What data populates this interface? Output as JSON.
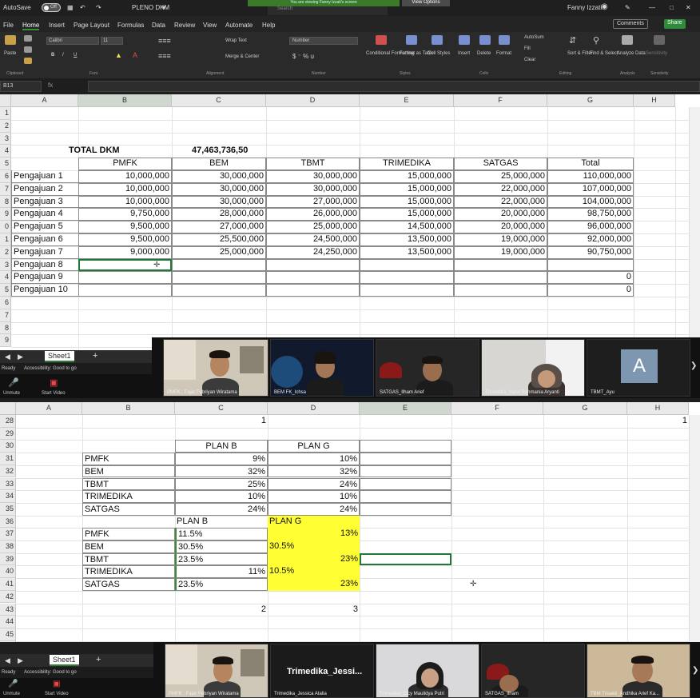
{
  "titlebar": {
    "autosave": "AutoSave",
    "toggle": "Off",
    "filename": "PLENO DKM",
    "banner": "You are viewing Fanny Izzati's screen",
    "banner_btn": "View Options",
    "search": "Search",
    "user": "Fanny Izzati"
  },
  "menu": [
    "File",
    "Home",
    "Insert",
    "Page Layout",
    "Formulas",
    "Data",
    "Review",
    "View",
    "Automate",
    "Help"
  ],
  "menu_right": {
    "comments": "Comments",
    "share": "Share"
  },
  "ribbon": {
    "groups": [
      "Clipboard",
      "Font",
      "Alignment",
      "Number",
      "Styles",
      "Cells",
      "Editing",
      "Analysis",
      "Sensitivity"
    ],
    "paste": "Paste",
    "font_name": "Calibri",
    "font_size": "11",
    "wrap": "Wrap Text",
    "merge": "Merge & Center",
    "number_format": "Number",
    "cond": "Conditional Formatting",
    "format_table": "Format as Table",
    "cell_styles": "Cell Styles",
    "insert": "Insert",
    "delete": "Delete",
    "format": "Format",
    "autosum": "AutoSum",
    "fill": "Fill",
    "clear": "Clear",
    "sort": "Sort & Filter",
    "find": "Find & Select",
    "analyze": "Analyze Data",
    "sensitivity": "Sensitivity"
  },
  "formula": {
    "namebox": "B13",
    "fx": "fx"
  },
  "top_sheet": {
    "columns": [
      "A",
      "B",
      "C",
      "D",
      "E",
      "F",
      "G",
      "H"
    ],
    "rows": [
      "1",
      "2",
      "3",
      "4",
      "5",
      "6",
      "7",
      "8",
      "9",
      "0",
      "1",
      "2",
      "3",
      "4",
      "5",
      "6",
      "7",
      "8",
      "9"
    ],
    "total_label": "TOTAL DKM",
    "total_value": "47,463,736,50",
    "headers": [
      "PMFK",
      "BEM",
      "TBMT",
      "TRIMEDIKA",
      "SATGAS",
      "Total"
    ],
    "data": [
      [
        "Pengajuan 1",
        "10,000,000",
        "30,000,000",
        "30,000,000",
        "15,000,000",
        "25,000,000",
        "110,000,000"
      ],
      [
        "Pengajuan 2",
        "10,000,000",
        "30,000,000",
        "30,000,000",
        "15,000,000",
        "22,000,000",
        "107,000,000"
      ],
      [
        "Pengajuan 3",
        "10,000,000",
        "30,000,000",
        "27,000,000",
        "15,000,000",
        "22,000,000",
        "104,000,000"
      ],
      [
        "Pengajuan 4",
        "9,750,000",
        "28,000,000",
        "26,000,000",
        "15,000,000",
        "20,000,000",
        "98,750,000"
      ],
      [
        "Pengajuan 5",
        "9,500,000",
        "27,000,000",
        "25,000,000",
        "14,500,000",
        "20,000,000",
        "96,000,000"
      ],
      [
        "Pengajuan 6",
        "9,500,000",
        "25,500,000",
        "24,500,000",
        "13,500,000",
        "19,000,000",
        "92,000,000"
      ],
      [
        "Pengajuan 7",
        "9,000,000",
        "25,000,000",
        "24,250,000",
        "13,500,000",
        "19,000,000",
        "90,750,000"
      ],
      [
        "Pengajuan 8",
        "",
        "",
        "",
        "",
        "",
        ""
      ],
      [
        "Pengajuan 9",
        "",
        "",
        "",
        "",
        "",
        "0"
      ],
      [
        "Pengajuan 10",
        "",
        "",
        "",
        "",
        "",
        "0"
      ]
    ]
  },
  "tabs": {
    "sheet": "Sheet1",
    "add": "+",
    "status_ready": "Ready",
    "accessibility": "Accessibility: Good to go"
  },
  "zoom_top": {
    "controls": [
      "Unmute",
      "Start Video"
    ],
    "participants": [
      "PMFK : Fajar Febriyan Wiratama",
      "BEM FK_Ichsa",
      "SATGAS_Ilham Arief",
      "Trimedika_Nurul Rahmania Aryanti",
      "TBMT_Ayu"
    ],
    "avatar_letter": "A"
  },
  "bottom_sheet": {
    "columns": [
      "A",
      "B",
      "C",
      "D",
      "E",
      "F",
      "G",
      "H"
    ],
    "rows": [
      "28",
      "29",
      "30",
      "31",
      "32",
      "33",
      "34",
      "35",
      "36",
      "37",
      "38",
      "39",
      "40",
      "41",
      "42",
      "43",
      "44",
      "45",
      "46"
    ],
    "row28_c": "1",
    "row28_h": "1",
    "plan1_headers": [
      "PLAN B",
      "PLAN G"
    ],
    "plan1": [
      [
        "PMFK",
        "9%",
        "10%"
      ],
      [
        "BEM",
        "32%",
        "32%"
      ],
      [
        "TBMT",
        "25%",
        "24%"
      ],
      [
        "TRIMEDIKA",
        "10%",
        "10%"
      ],
      [
        "SATGAS",
        "24%",
        "24%"
      ]
    ],
    "plan2_headers": [
      "PLAN B",
      "PLAN G"
    ],
    "plan2": [
      [
        "PMFK",
        "11.5%",
        "13%"
      ],
      [
        "BEM",
        "30.5%",
        "30.5%"
      ],
      [
        "TBMT",
        "23.5%",
        "23%"
      ],
      [
        "TRIMEDIKA",
        "11%",
        "10.5%"
      ],
      [
        "SATGAS",
        "23.5%",
        "23%"
      ]
    ],
    "row43_c": "2",
    "row43_d": "3"
  },
  "zoom_bottom": {
    "participants": [
      "PMFK : Fajar Febriyan Wiratama",
      "Trimedika_Jessica Atalia",
      "Trimedika_Cicy Maulidya Putri",
      "SATGAS_Ilham",
      "TBM Trisakti_Andhika Arief Ka..."
    ],
    "big_name": "Trimedika_Jessi..."
  }
}
